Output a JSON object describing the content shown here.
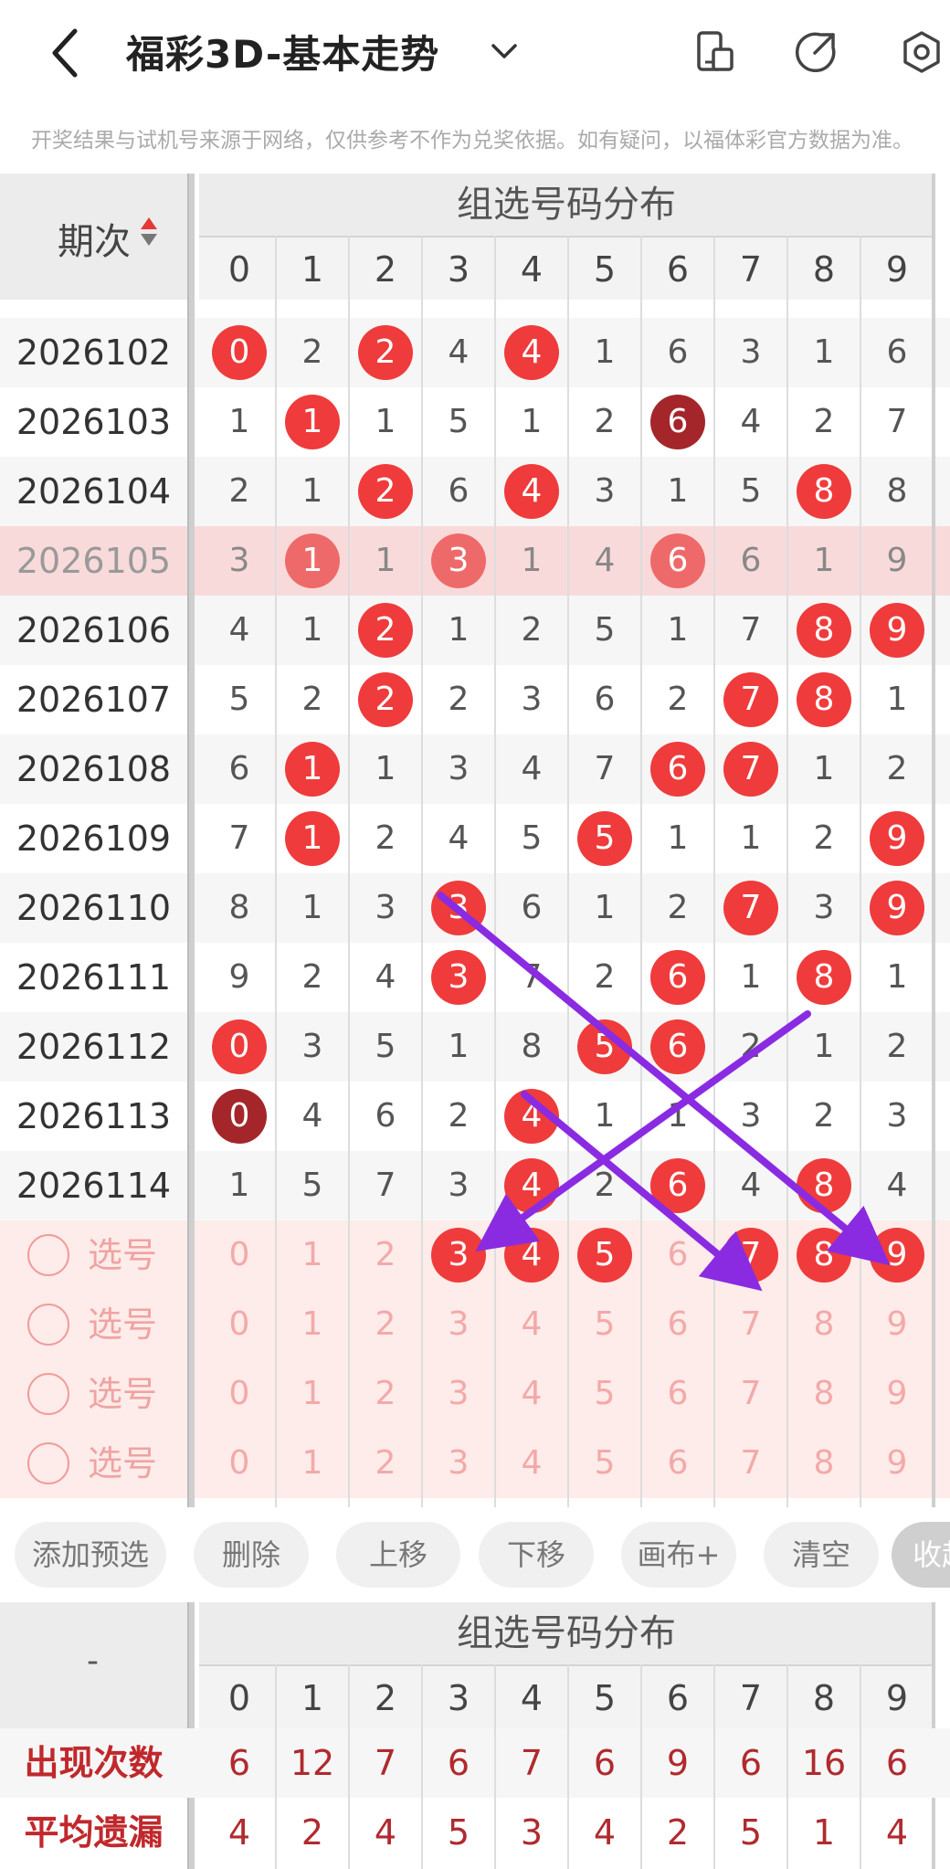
{
  "header": {
    "title": "福彩3D-基本走势",
    "notice": "开奖结果与试机号来源于网络，仅供参考不作为兑奖依据。如有疑问，以福体彩官方数据为准。"
  },
  "table": {
    "issue_label": "期次",
    "group_title": "组选号码分布",
    "digits": [
      "0",
      "1",
      "2",
      "3",
      "4",
      "5",
      "6",
      "7",
      "8",
      "9"
    ],
    "rows": [
      {
        "issue": "2026102",
        "cells": [
          "0",
          "2",
          "2",
          "4",
          "4",
          "1",
          "6",
          "3",
          "1",
          "6"
        ],
        "balls": [
          0,
          2,
          4
        ],
        "dark": []
      },
      {
        "issue": "2026103",
        "cells": [
          "1",
          "1",
          "1",
          "5",
          "1",
          "2",
          "6",
          "4",
          "2",
          "7"
        ],
        "balls": [
          1
        ],
        "dark": [
          6
        ]
      },
      {
        "issue": "2026104",
        "cells": [
          "2",
          "1",
          "2",
          "6",
          "4",
          "3",
          "1",
          "5",
          "8",
          "8"
        ],
        "balls": [
          2,
          4,
          8
        ],
        "dark": []
      },
      {
        "issue": "2026105",
        "cells": [
          "3",
          "1",
          "1",
          "3",
          "1",
          "4",
          "6",
          "6",
          "1",
          "9"
        ],
        "balls": [
          1,
          3,
          6
        ],
        "dark": [],
        "highlight": true
      },
      {
        "issue": "2026106",
        "cells": [
          "4",
          "1",
          "2",
          "1",
          "2",
          "5",
          "1",
          "7",
          "8",
          "9"
        ],
        "balls": [
          2,
          8,
          9
        ],
        "dark": []
      },
      {
        "issue": "2026107",
        "cells": [
          "5",
          "2",
          "2",
          "2",
          "3",
          "6",
          "2",
          "7",
          "8",
          "1"
        ],
        "balls": [
          2,
          7,
          8
        ],
        "dark": []
      },
      {
        "issue": "2026108",
        "cells": [
          "6",
          "1",
          "1",
          "3",
          "4",
          "7",
          "6",
          "7",
          "1",
          "2"
        ],
        "balls": [
          1,
          6,
          7
        ],
        "dark": []
      },
      {
        "issue": "2026109",
        "cells": [
          "7",
          "1",
          "2",
          "4",
          "5",
          "5",
          "1",
          "1",
          "2",
          "9"
        ],
        "balls": [
          1,
          5,
          9
        ],
        "dark": []
      },
      {
        "issue": "2026110",
        "cells": [
          "8",
          "1",
          "3",
          "3",
          "6",
          "1",
          "2",
          "7",
          "3",
          "9"
        ],
        "balls": [
          3,
          7,
          9
        ],
        "dark": []
      },
      {
        "issue": "2026111",
        "cells": [
          "9",
          "2",
          "4",
          "3",
          "7",
          "2",
          "6",
          "1",
          "8",
          "1"
        ],
        "balls": [
          3,
          6,
          8
        ],
        "dark": []
      },
      {
        "issue": "2026112",
        "cells": [
          "0",
          "3",
          "5",
          "1",
          "8",
          "5",
          "6",
          "2",
          "1",
          "2"
        ],
        "balls": [
          0,
          5,
          6
        ],
        "dark": []
      },
      {
        "issue": "2026113",
        "cells": [
          "0",
          "4",
          "6",
          "2",
          "4",
          "1",
          "1",
          "3",
          "2",
          "3"
        ],
        "balls": [
          4
        ],
        "dark": [
          0
        ]
      },
      {
        "issue": "2026114",
        "cells": [
          "1",
          "5",
          "7",
          "3",
          "4",
          "2",
          "6",
          "4",
          "8",
          "4"
        ],
        "balls": [
          4,
          6,
          8
        ],
        "dark": []
      }
    ],
    "selection_rows": [
      {
        "label": "选号",
        "cells": [
          "0",
          "1",
          "2",
          "3",
          "4",
          "5",
          "6",
          "7",
          "8",
          "9"
        ],
        "balls": [
          3,
          4,
          5,
          7,
          8,
          9
        ]
      },
      {
        "label": "选号",
        "cells": [
          "0",
          "1",
          "2",
          "3",
          "4",
          "5",
          "6",
          "7",
          "8",
          "9"
        ],
        "balls": []
      },
      {
        "label": "选号",
        "cells": [
          "0",
          "1",
          "2",
          "3",
          "4",
          "5",
          "6",
          "7",
          "8",
          "9"
        ],
        "balls": []
      },
      {
        "label": "选号",
        "cells": [
          "0",
          "1",
          "2",
          "3",
          "4",
          "5",
          "6",
          "7",
          "8",
          "9"
        ],
        "balls": []
      }
    ]
  },
  "buttons": [
    "添加预选",
    "删除",
    "上移",
    "下移",
    "画布+",
    "清空",
    "收起"
  ],
  "summary": {
    "dash": "-",
    "group_title": "组选号码分布",
    "digits": [
      "0",
      "1",
      "2",
      "3",
      "4",
      "5",
      "6",
      "7",
      "8",
      "9"
    ],
    "rows": [
      {
        "label": "出现次数",
        "values": [
          "6",
          "12",
          "7",
          "6",
          "7",
          "6",
          "9",
          "6",
          "16",
          "6"
        ]
      },
      {
        "label": "平均遗漏",
        "values": [
          "4",
          "2",
          "4",
          "5",
          "3",
          "4",
          "2",
          "5",
          "1",
          "4"
        ]
      }
    ]
  },
  "colors": {
    "ball": "#ef3b3b",
    "ball_dark": "#a4262a",
    "arrow": "#8a2be2",
    "highlight_row": "#f9dadb"
  }
}
